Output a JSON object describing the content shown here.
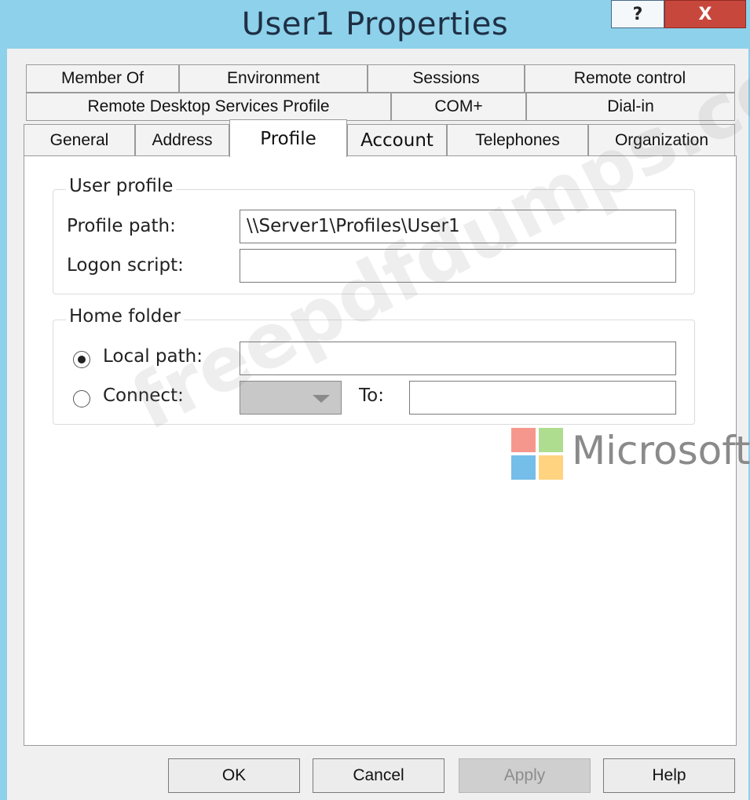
{
  "window": {
    "title": "User1 Properties",
    "help_label": "?",
    "close_label": "X"
  },
  "tabs": {
    "row1": [
      "Member Of",
      "Environment",
      "Sessions",
      "Remote control"
    ],
    "row2": [
      "Remote Desktop Services Profile",
      "COM+",
      "Dial-in"
    ],
    "row3": [
      "General",
      "Address",
      "Profile",
      "Account",
      "Telephones",
      "Organization"
    ],
    "active": "Profile"
  },
  "user_profile": {
    "legend": "User profile",
    "profile_path_label": "Profile path:",
    "profile_path_value": "\\\\Server1\\Profiles\\User1",
    "logon_script_label": "Logon script:",
    "logon_script_value": ""
  },
  "home_folder": {
    "legend": "Home folder",
    "local_path_label": "Local path:",
    "local_path_value": "",
    "local_path_selected": true,
    "connect_label": "Connect:",
    "connect_selected": false,
    "to_label": "To:",
    "to_value": ""
  },
  "buttons": {
    "ok": "OK",
    "cancel": "Cancel",
    "apply": "Apply",
    "help": "Help"
  },
  "overlay": {
    "watermark": "freepdfdumps.com",
    "logo_text": "Microsoft",
    "logo_colors": [
      "#f26b5c",
      "#8ccf5f",
      "#3aa3e0",
      "#ffc14a"
    ]
  }
}
